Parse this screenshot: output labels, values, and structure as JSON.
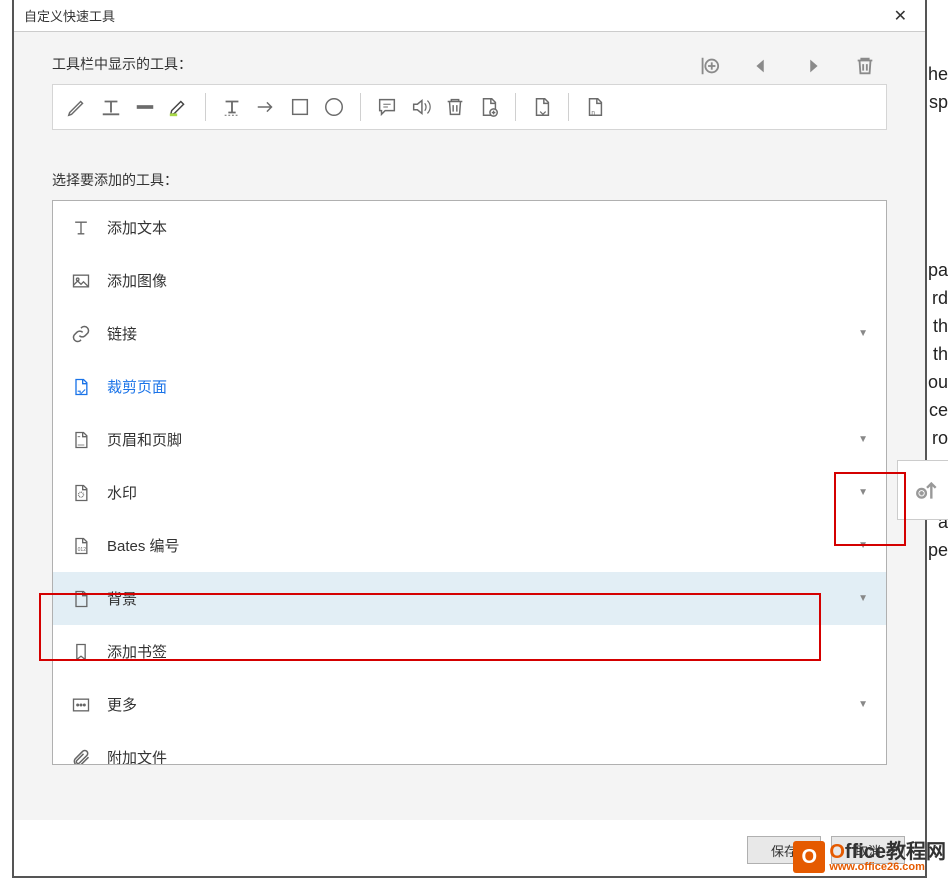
{
  "dialog": {
    "title": "自定义快速工具"
  },
  "section1_label": "工具栏中显示的工具：",
  "section2_label": "选择要添加的工具：",
  "actions": {
    "add_separator": "add-separator",
    "move_left": "move-left",
    "move_right": "move-right",
    "delete": "delete"
  },
  "toolbar": [
    {
      "name": "pencil-icon"
    },
    {
      "name": "text-typewriter-icon"
    },
    {
      "name": "strikethrough-icon"
    },
    {
      "name": "highlighter-icon"
    },
    {
      "sep": true
    },
    {
      "name": "text-mark-icon"
    },
    {
      "name": "arrow-right-icon"
    },
    {
      "name": "square-icon"
    },
    {
      "name": "circle-icon"
    },
    {
      "sep": true
    },
    {
      "name": "comment-icon"
    },
    {
      "name": "reply-icon"
    },
    {
      "name": "trash-icon"
    },
    {
      "name": "page-add-icon"
    },
    {
      "sep": true
    },
    {
      "name": "page-down-icon"
    },
    {
      "sep": true
    },
    {
      "name": "page-count-icon"
    }
  ],
  "tools": [
    {
      "icon": "T",
      "label": "添加文本",
      "dropdown": false
    },
    {
      "icon": "image",
      "label": "添加图像",
      "dropdown": false
    },
    {
      "icon": "link",
      "label": "链接",
      "dropdown": true
    },
    {
      "icon": "crop",
      "label": "裁剪页面",
      "dropdown": false,
      "active": true
    },
    {
      "icon": "page",
      "label": "页眉和页脚",
      "dropdown": true
    },
    {
      "icon": "watermark",
      "label": "水印",
      "dropdown": true
    },
    {
      "icon": "bates",
      "label": "Bates 编号",
      "dropdown": true
    },
    {
      "icon": "page",
      "label": "背景",
      "dropdown": true,
      "selected": true
    },
    {
      "icon": "bookmark",
      "label": "添加书签",
      "dropdown": false
    },
    {
      "icon": "more",
      "label": "更多",
      "dropdown": true
    },
    {
      "icon": "attach",
      "label": "附加文件",
      "dropdown": false
    }
  ],
  "buttons": {
    "save": "保存",
    "cancel": "取消"
  },
  "watermark": {
    "brand": "Office教程网",
    "url": "www.office26.com"
  }
}
